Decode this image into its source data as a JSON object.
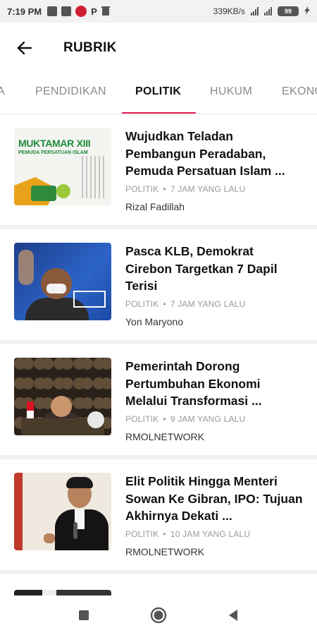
{
  "status_bar": {
    "time": "7:19 PM",
    "letter_p": "P",
    "network_speed": "339KB/s",
    "battery_level": "99"
  },
  "header": {
    "title": "RUBRIK",
    "back_icon": "arrow-left-icon"
  },
  "tabs": [
    {
      "label": "A",
      "active": false
    },
    {
      "label": "PENDIDIKAN",
      "active": false
    },
    {
      "label": "POLITIK",
      "active": true
    },
    {
      "label": "HUKUM",
      "active": false
    },
    {
      "label": "EKONO",
      "active": false
    }
  ],
  "colors": {
    "accent": "#e5194d",
    "muted_text": "#9a9a9a",
    "divider": "#f1f1f1"
  },
  "articles": [
    {
      "title": "Wujudkan Teladan Pembangun Peradaban, Pemuda Persatuan Islam ...",
      "category": "POLITIK",
      "time": "7 JAM YANG LALU",
      "author": "Rizal Fadillah",
      "thumb_text_1": "MUKTAMAR XIII",
      "thumb_text_2": "PEMUDA PERSATUAN ISLAM"
    },
    {
      "title": "Pasca KLB, Demokrat Cirebon Targetkan 7 Dapil Terisi",
      "category": "POLITIK",
      "time": "7 JAM YANG LALU",
      "author": "Yon Maryono"
    },
    {
      "title": "Pemerintah Dorong Pertumbuhan Ekonomi Melalui Transformasi ...",
      "category": "POLITIK",
      "time": "9 JAM YANG LALU",
      "author": "RMOLNETWORK"
    },
    {
      "title": "Elit Politik Hingga Menteri Sowan Ke Gibran, IPO: Tujuan Akhirnya Dekati ...",
      "category": "POLITIK",
      "time": "10 JAM YANG LALU",
      "author": "RMOLNETWORK"
    }
  ],
  "nav": {
    "recent": "square-icon",
    "home": "circle-icon",
    "back": "triangle-back-icon"
  }
}
